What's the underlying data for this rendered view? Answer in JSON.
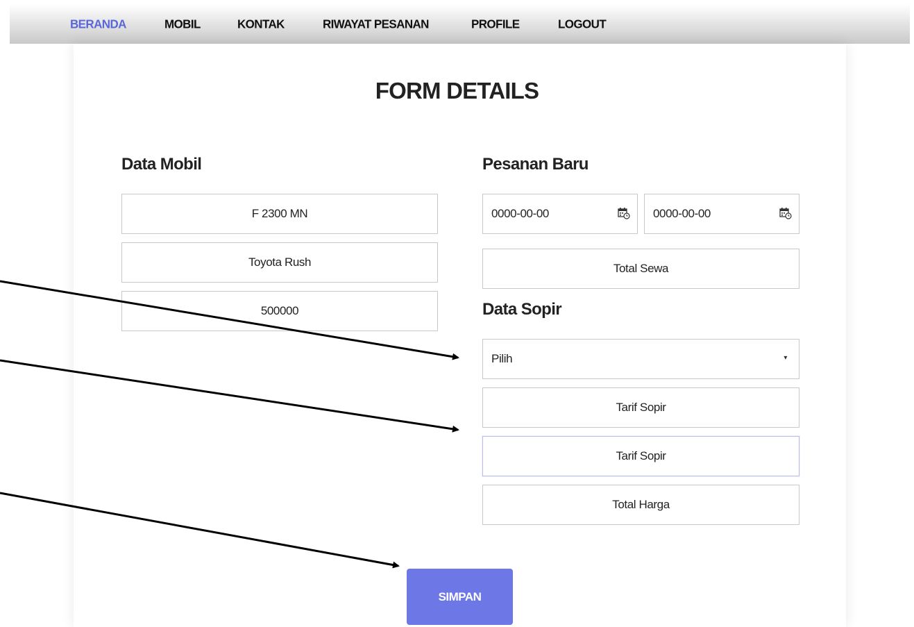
{
  "nav": {
    "items": [
      "BERANDA",
      "MOBIL",
      "KONTAK",
      "RIWAYAT PESANAN",
      "PROFILE",
      "LOGOUT"
    ],
    "active": "BERANDA",
    "active_color": "#5b67d8"
  },
  "page": {
    "title": "FORM DETAILS"
  },
  "data_mobil": {
    "heading": "Data Mobil",
    "plate": "F 2300 MN",
    "model": "Toyota Rush",
    "price": "500000"
  },
  "pesanan_baru": {
    "heading": "Pesanan Baru",
    "start_date": "0000-00-00",
    "end_date": "0000-00-00",
    "total_sewa_placeholder": "Total Sewa"
  },
  "data_sopir": {
    "heading": "Data Sopir",
    "select_value": "Pilih",
    "tarif_sopir_placeholder": "Tarif Sopir",
    "tarif_sopir_2_placeholder": "Tarif Sopir",
    "total_harga_placeholder": "Total Harga"
  },
  "actions": {
    "save_label": "SIMPAN",
    "save_color": "#6d78e6"
  },
  "icons": {
    "date": "calendar-clock-icon",
    "select": "caret-down-icon"
  }
}
